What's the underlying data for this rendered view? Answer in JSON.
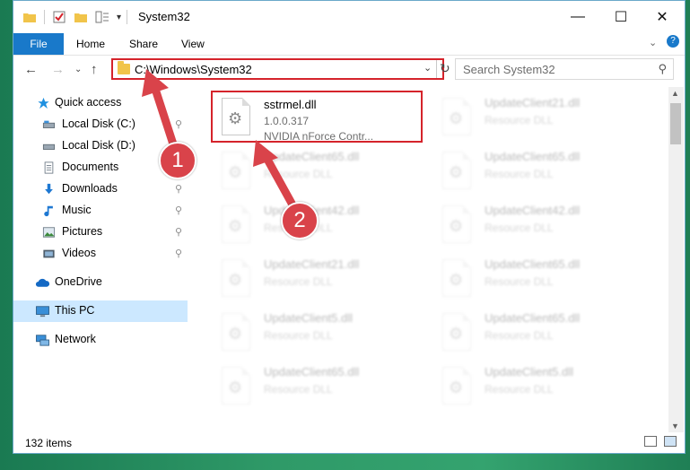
{
  "window": {
    "title": "System32"
  },
  "ribbon": {
    "tabs": [
      "File",
      "Home",
      "Share",
      "View"
    ]
  },
  "address": {
    "path": "C:\\Windows\\System32",
    "search_placeholder": "Search System32"
  },
  "nav_pane": {
    "items": [
      {
        "label": "Quick access",
        "icon": "star-icon",
        "pinned": false
      },
      {
        "label": "Local Disk (C:)",
        "icon": "drive-icon",
        "pinned": true
      },
      {
        "label": "Local Disk (D:)",
        "icon": "drive-icon",
        "pinned": false
      },
      {
        "label": "Documents",
        "icon": "documents-icon",
        "pinned": true
      },
      {
        "label": "Downloads",
        "icon": "download-icon",
        "pinned": true
      },
      {
        "label": "Music",
        "icon": "music-icon",
        "pinned": true
      },
      {
        "label": "Pictures",
        "icon": "pictures-icon",
        "pinned": true
      },
      {
        "label": "Videos",
        "icon": "videos-icon",
        "pinned": true
      },
      {
        "label": "OneDrive",
        "icon": "cloud-icon",
        "pinned": false
      },
      {
        "label": "This PC",
        "icon": "computer-icon",
        "pinned": false,
        "selected": true
      },
      {
        "label": "Network",
        "icon": "network-icon",
        "pinned": false
      }
    ]
  },
  "files": [
    {
      "name": "sstrmel.dll",
      "version": "1.0.0.317",
      "description": "NVIDIA nForce Contr...",
      "highlighted": true
    },
    {
      "name": "UpdateClient21.dll",
      "description": "Resource DLL"
    },
    {
      "name": "UpdateClient65.dll",
      "description": "Resource DLL"
    },
    {
      "name": "UpdateClient65.dll",
      "description": "Resource DLL"
    },
    {
      "name": "UpdateClient42.dll",
      "description": "Resource DLL"
    },
    {
      "name": "UpdateClient42.dll",
      "description": "Resource DLL"
    },
    {
      "name": "UpdateClient21.dll",
      "description": "Resource DLL"
    },
    {
      "name": "UpdateClient65.dll",
      "description": "Resource DLL"
    },
    {
      "name": "UpdateClient5.dll",
      "description": "Resource DLL"
    },
    {
      "name": "UpdateClient65.dll",
      "description": "Resource DLL"
    },
    {
      "name": "UpdateClient65.dll",
      "description": "Resource DLL"
    },
    {
      "name": "UpdateClient5.dll",
      "description": "Resource DLL"
    }
  ],
  "status": {
    "item_count": "132 items"
  },
  "annotations": {
    "step1": "1",
    "step2": "2",
    "color": "#d9434a"
  }
}
